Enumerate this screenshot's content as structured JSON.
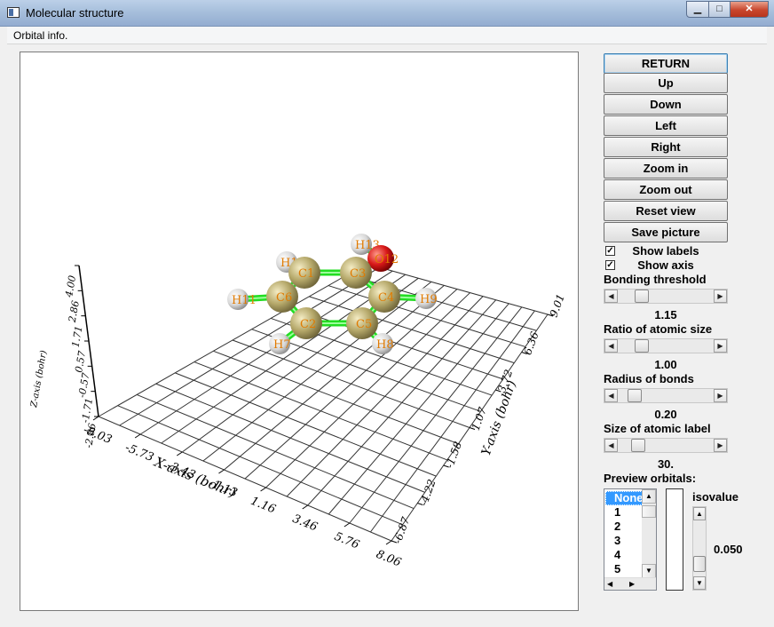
{
  "window": {
    "title": "Molecular structure",
    "title_bar_color": "#a7bfdc"
  },
  "menu": {
    "items": [
      "Orbital info."
    ]
  },
  "controls": {
    "buttons": [
      "RETURN",
      "Up",
      "Down",
      "Left",
      "Right",
      "Zoom in",
      "Zoom out",
      "Reset view",
      "Save picture"
    ],
    "show_labels": {
      "label": "Show labels",
      "checked": true
    },
    "show_axis": {
      "label": "Show axis",
      "checked": true
    },
    "bonding_threshold": {
      "label": "Bonding threshold",
      "value": "1.15"
    },
    "atomic_size_ratio": {
      "label": "Ratio of atomic size",
      "value": "1.00"
    },
    "bond_radius": {
      "label": "Radius of bonds",
      "value": "0.20"
    },
    "label_size": {
      "label": "Size of atomic label",
      "value": "30."
    },
    "preview_orbitals": {
      "label": "Preview orbitals:",
      "items": [
        "None",
        "1",
        "2",
        "3",
        "4",
        "5"
      ],
      "selected": "None"
    },
    "isovalue": {
      "label": "isovalue",
      "value": "0.050"
    }
  },
  "plot": {
    "axes": {
      "x_label": "X-axis (bohr)",
      "y_label": "Y-axis (bohr)",
      "z_label": "Z-axis (bohr)",
      "x_ticks": [
        "-8.03",
        "-5.73",
        "-3.43",
        "-1.13",
        "1.16",
        "3.46",
        "5.76",
        "8.06"
      ],
      "y_ticks": [
        "-6.87",
        "-4.22",
        "-1.58",
        "1.07",
        "3.72",
        "6.36",
        "9.01"
      ],
      "z_ticks": [
        "-2.86",
        "-1.71",
        "-0.57",
        "0.57",
        "1.71",
        "2.86",
        "4.00"
      ]
    },
    "atoms": [
      {
        "label": "C1",
        "element": "C"
      },
      {
        "label": "C2",
        "element": "C"
      },
      {
        "label": "C3",
        "element": "C"
      },
      {
        "label": "C4",
        "element": "C"
      },
      {
        "label": "C5",
        "element": "C"
      },
      {
        "label": "C6",
        "element": "C"
      },
      {
        "label": "H7",
        "element": "H"
      },
      {
        "label": "H8",
        "element": "H"
      },
      {
        "label": "H9",
        "element": "H"
      },
      {
        "label": "H10",
        "element": "H"
      },
      {
        "label": "H11",
        "element": "H"
      },
      {
        "label": "O12",
        "element": "O"
      },
      {
        "label": "H13",
        "element": "H"
      }
    ],
    "colors": {
      "carbon": "#b5a86a",
      "hydrogen": "#d8d8d8",
      "oxygen": "#d81818",
      "bond": "#22dd22",
      "label": "#e07a00",
      "grid": "#333333"
    }
  }
}
